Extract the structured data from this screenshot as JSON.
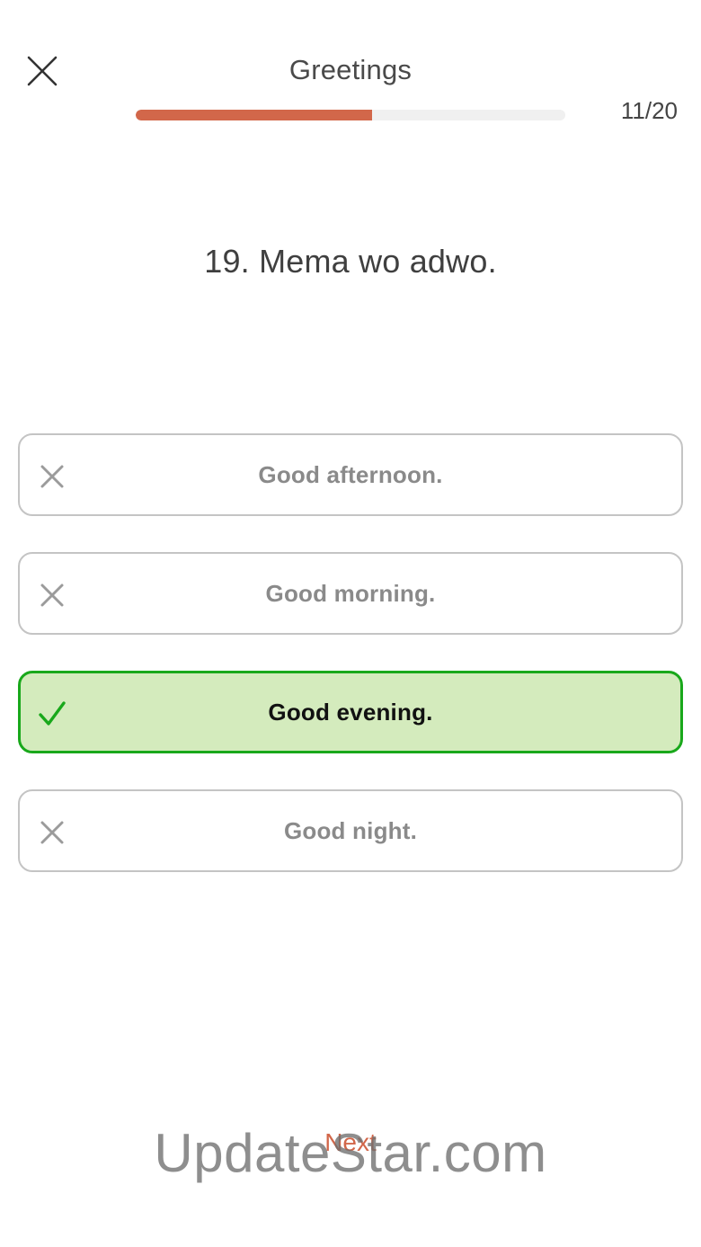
{
  "header": {
    "title": "Greetings",
    "progress": {
      "current": 11,
      "total": 20,
      "label": "11/20",
      "fill_fraction": 0.55,
      "color": "#d2674a"
    }
  },
  "question": {
    "text": "19. Mema wo adwo."
  },
  "options": [
    {
      "label": "Good afternoon.",
      "state": "wrong",
      "icon": "x-mark-icon"
    },
    {
      "label": "Good morning.",
      "state": "wrong",
      "icon": "x-mark-icon"
    },
    {
      "label": "Good evening.",
      "state": "correct",
      "icon": "checkmark-icon"
    },
    {
      "label": "Good night.",
      "state": "wrong",
      "icon": "x-mark-icon"
    }
  ],
  "colors": {
    "correct_border": "#19a81b",
    "correct_background": "#d4ebbd",
    "accent": "#d2674a"
  },
  "footer": {
    "next_label": "Next"
  },
  "watermark": {
    "text": "UpdateStar.com"
  }
}
